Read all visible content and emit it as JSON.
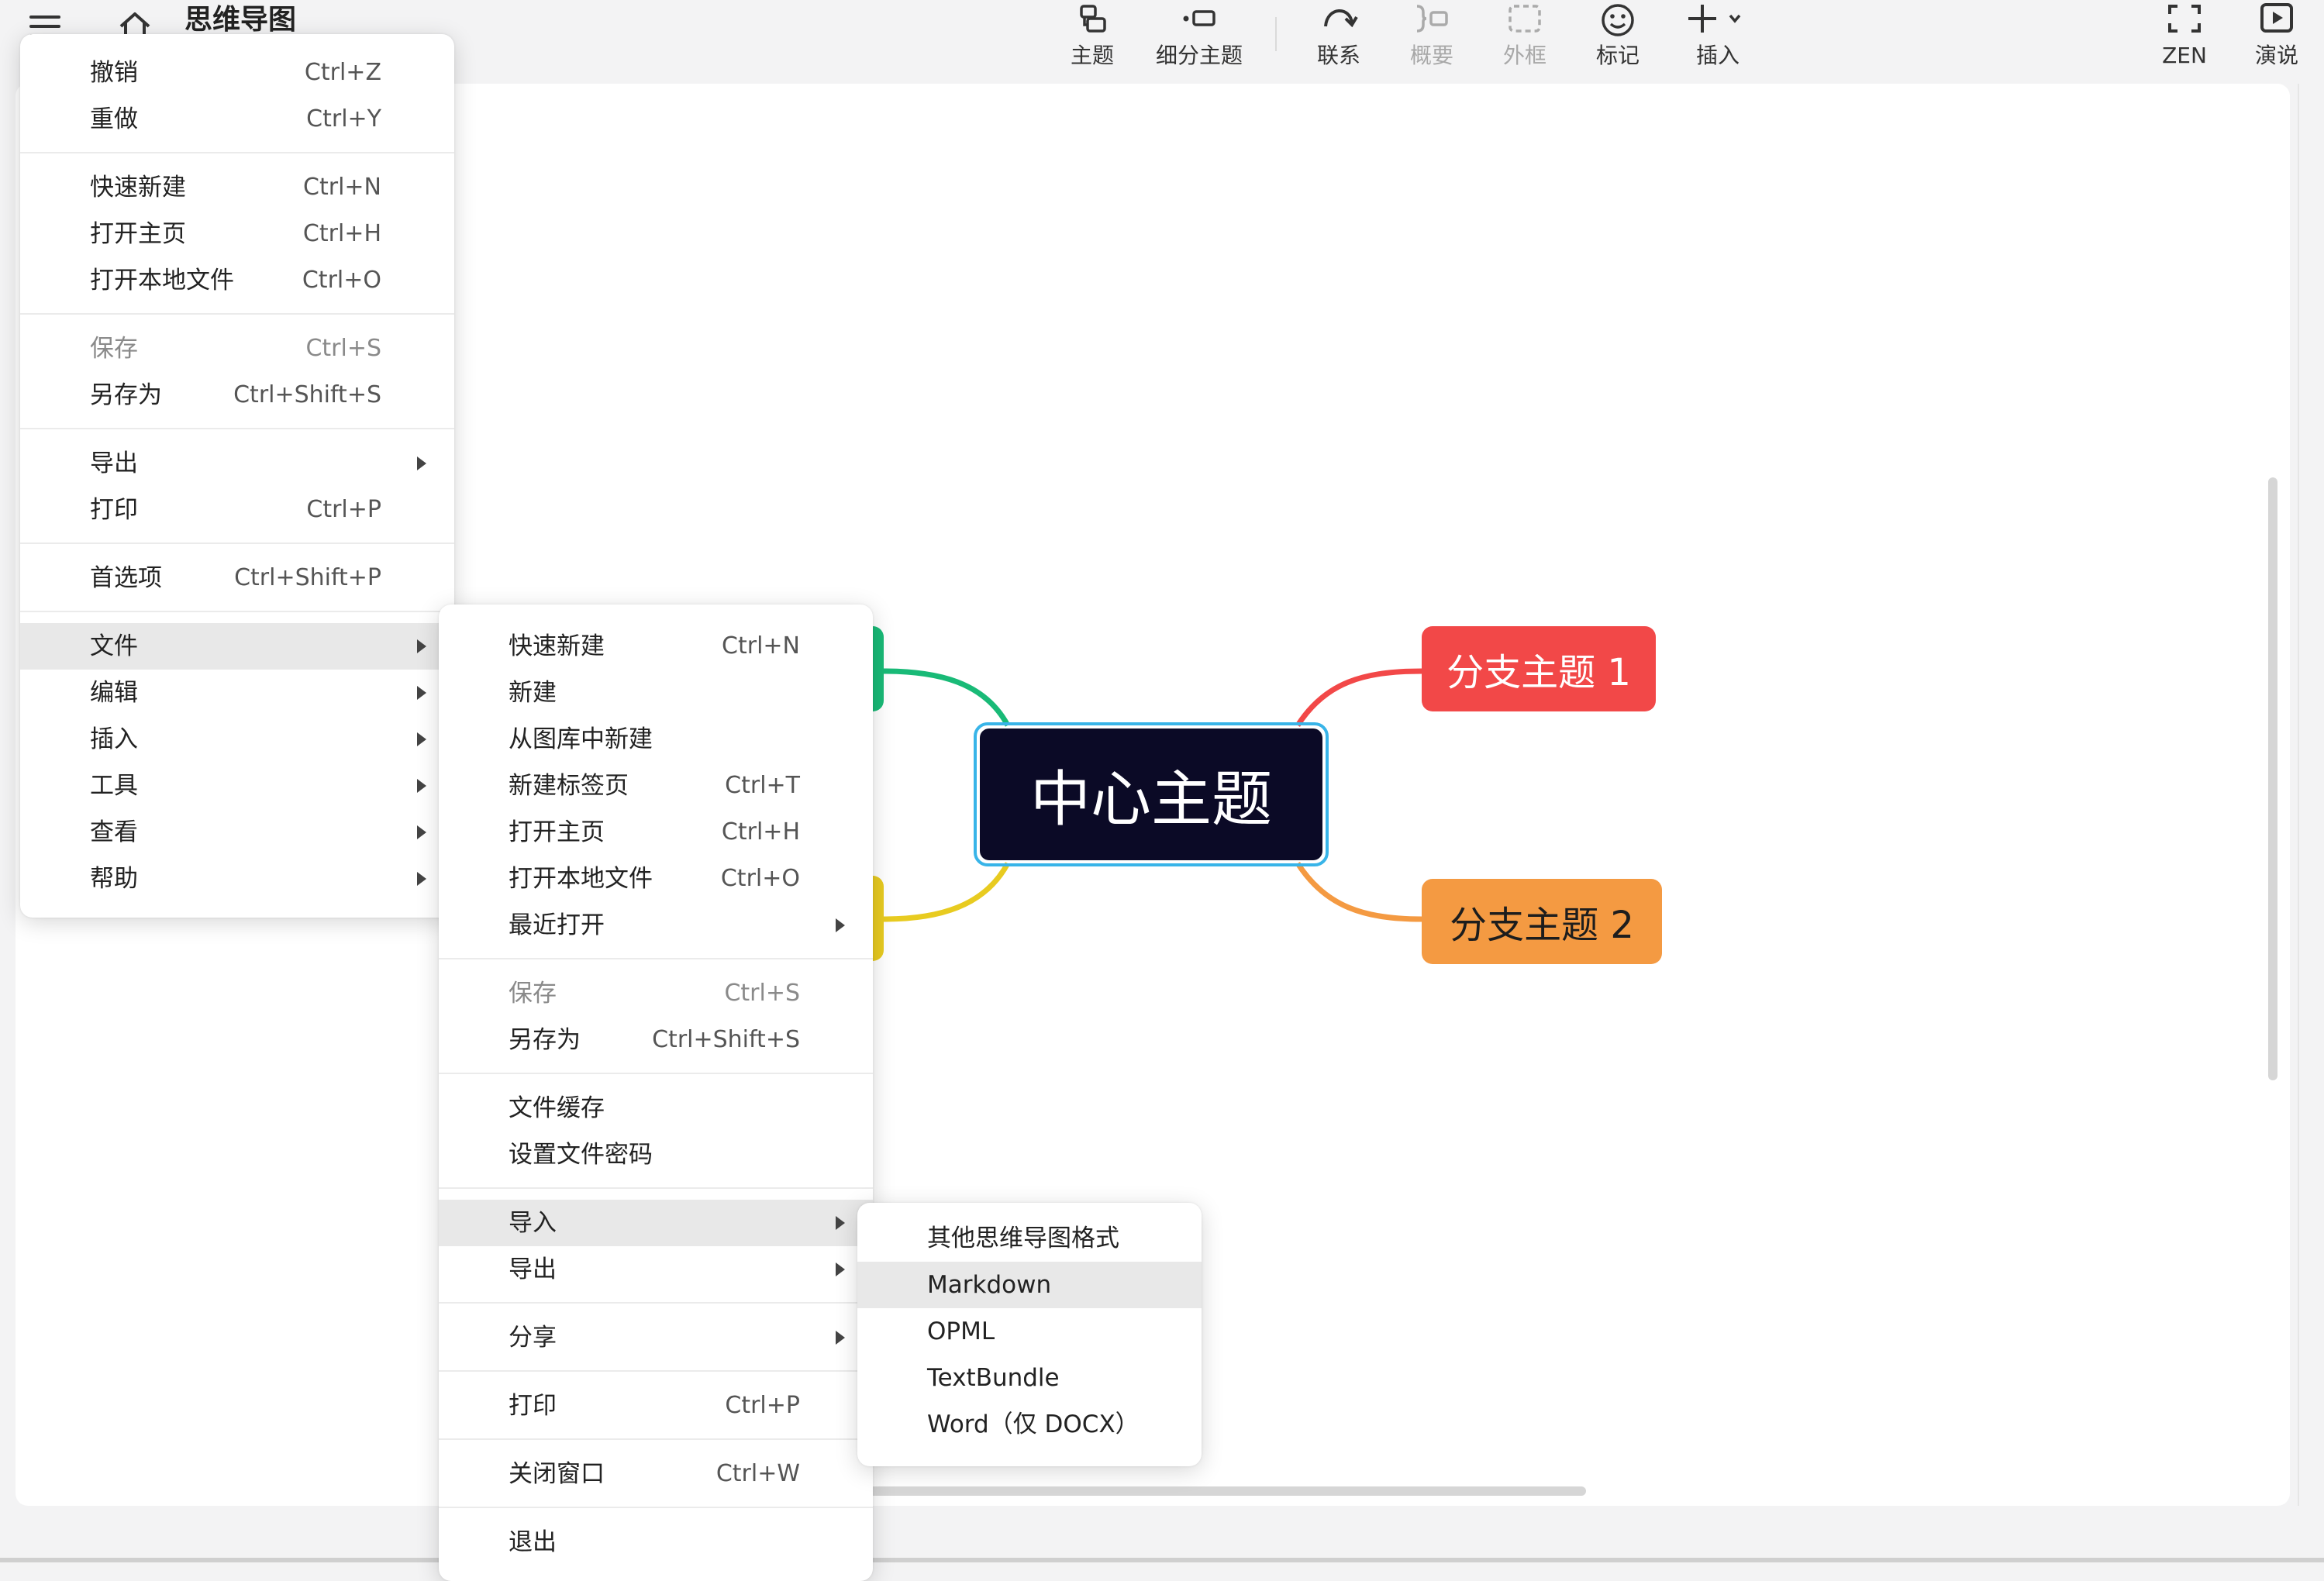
{
  "app": {
    "doc_title": "思维导图"
  },
  "toolbar": {
    "tools": [
      {
        "label": "主题",
        "icon": "topic-icon",
        "enabled": true
      },
      {
        "label": "细分主题",
        "icon": "subtopic-icon",
        "enabled": true
      },
      {
        "label": "联系",
        "icon": "relationship-icon",
        "enabled": true
      },
      {
        "label": "概要",
        "icon": "summary-icon",
        "enabled": false
      },
      {
        "label": "外框",
        "icon": "boundary-icon",
        "enabled": false
      },
      {
        "label": "标记",
        "icon": "marker-icon",
        "enabled": true
      },
      {
        "label": "插入",
        "icon": "insert-icon",
        "enabled": true
      },
      {
        "label": "ZEN",
        "icon": "fullscreen-icon",
        "enabled": true
      },
      {
        "label": "演说",
        "icon": "pitch-icon",
        "enabled": true
      }
    ]
  },
  "mindmap": {
    "central": "中心主题",
    "branches": [
      {
        "label": "分支主题 1",
        "color": "#f24848"
      },
      {
        "label": "分支主题 2",
        "color": "#f49a42"
      }
    ],
    "hidden_branch_colors": [
      "#19ba77",
      "#e8cb20"
    ],
    "central_color": "#0b0a26",
    "selection_color": "#38b4e8"
  },
  "main_menu": {
    "items": [
      {
        "label": "撤销",
        "shortcut": "Ctrl+Z"
      },
      {
        "label": "重做",
        "shortcut": "Ctrl+Y"
      },
      {
        "label": "快速新建",
        "shortcut": "Ctrl+N"
      },
      {
        "label": "打开主页",
        "shortcut": "Ctrl+H"
      },
      {
        "label": "打开本地文件",
        "shortcut": "Ctrl+O"
      },
      {
        "label": "保存",
        "shortcut": "Ctrl+S"
      },
      {
        "label": "另存为",
        "shortcut": "Ctrl+Shift+S"
      },
      {
        "label": "导出",
        "shortcut": ""
      },
      {
        "label": "打印",
        "shortcut": "Ctrl+P"
      },
      {
        "label": "首选项",
        "shortcut": "Ctrl+Shift+P"
      },
      {
        "label": "文件",
        "shortcut": ""
      },
      {
        "label": "编辑",
        "shortcut": ""
      },
      {
        "label": "插入",
        "shortcut": ""
      },
      {
        "label": "工具",
        "shortcut": ""
      },
      {
        "label": "查看",
        "shortcut": ""
      },
      {
        "label": "帮助",
        "shortcut": ""
      }
    ]
  },
  "file_menu": {
    "items": [
      {
        "label": "快速新建",
        "shortcut": "Ctrl+N"
      },
      {
        "label": "新建",
        "shortcut": ""
      },
      {
        "label": "从图库中新建",
        "shortcut": ""
      },
      {
        "label": "新建标签页",
        "shortcut": "Ctrl+T"
      },
      {
        "label": "打开主页",
        "shortcut": "Ctrl+H"
      },
      {
        "label": "打开本地文件",
        "shortcut": "Ctrl+O"
      },
      {
        "label": "最近打开",
        "shortcut": ""
      },
      {
        "label": "保存",
        "shortcut": "Ctrl+S"
      },
      {
        "label": "另存为",
        "shortcut": "Ctrl+Shift+S"
      },
      {
        "label": "文件缓存",
        "shortcut": ""
      },
      {
        "label": "设置文件密码",
        "shortcut": ""
      },
      {
        "label": "导入",
        "shortcut": ""
      },
      {
        "label": "导出",
        "shortcut": ""
      },
      {
        "label": "分享",
        "shortcut": ""
      },
      {
        "label": "打印",
        "shortcut": "Ctrl+P"
      },
      {
        "label": "关闭窗口",
        "shortcut": "Ctrl+W"
      },
      {
        "label": "退出",
        "shortcut": ""
      }
    ]
  },
  "import_menu": {
    "items": [
      {
        "label": "其他思维导图格式"
      },
      {
        "label": "Markdown"
      },
      {
        "label": "OPML"
      },
      {
        "label": "TextBundle"
      },
      {
        "label": "Word（仅 DOCX）"
      }
    ]
  }
}
